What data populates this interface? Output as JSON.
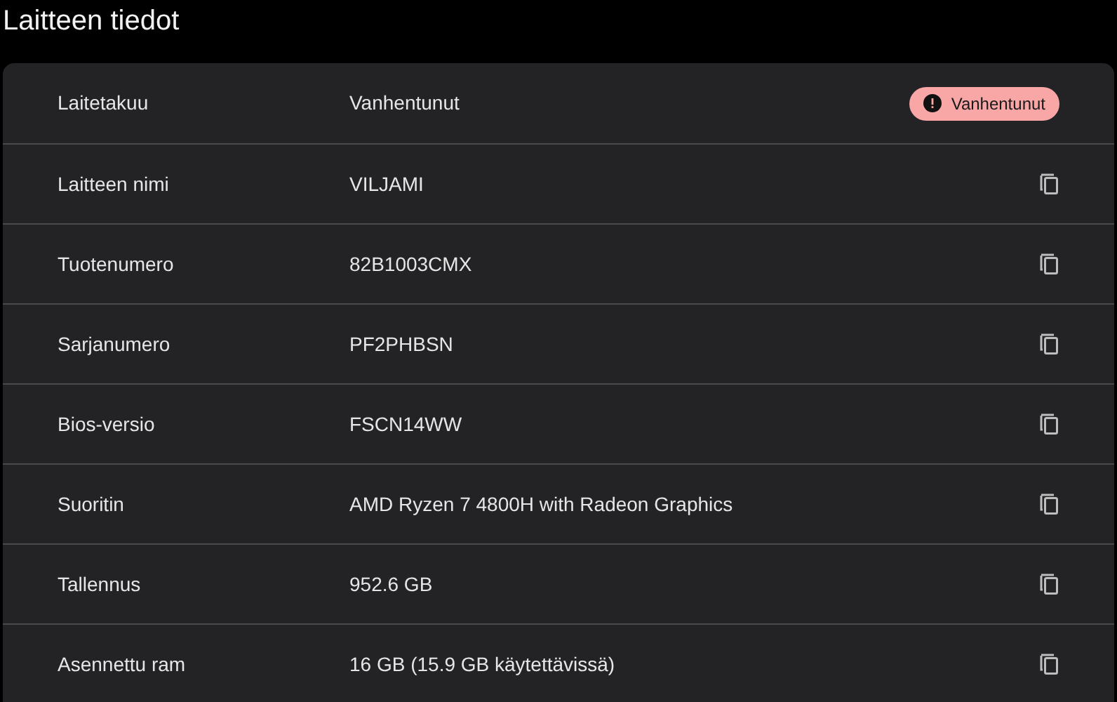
{
  "title": "Laitteen tiedot",
  "rows": [
    {
      "label": "Laitetakuu",
      "value": "Vanhentunut",
      "kind": "badge",
      "badge": "Vanhentunut"
    },
    {
      "label": "Laitteen nimi",
      "value": "VILJAMI",
      "kind": "copy"
    },
    {
      "label": "Tuotenumero",
      "value": "82B1003CMX",
      "kind": "copy"
    },
    {
      "label": "Sarjanumero",
      "value": "PF2PHBSN",
      "kind": "copy"
    },
    {
      "label": "Bios-versio",
      "value": "FSCN14WW",
      "kind": "copy"
    },
    {
      "label": "Suoritin",
      "value": "AMD Ryzen 7 4800H with Radeon Graphics",
      "kind": "copy"
    },
    {
      "label": "Tallennus",
      "value": "952.6 GB",
      "kind": "copy"
    },
    {
      "label": "Asennettu ram",
      "value": "16 GB (15.9 GB käytettävissä)",
      "kind": "copy"
    }
  ]
}
